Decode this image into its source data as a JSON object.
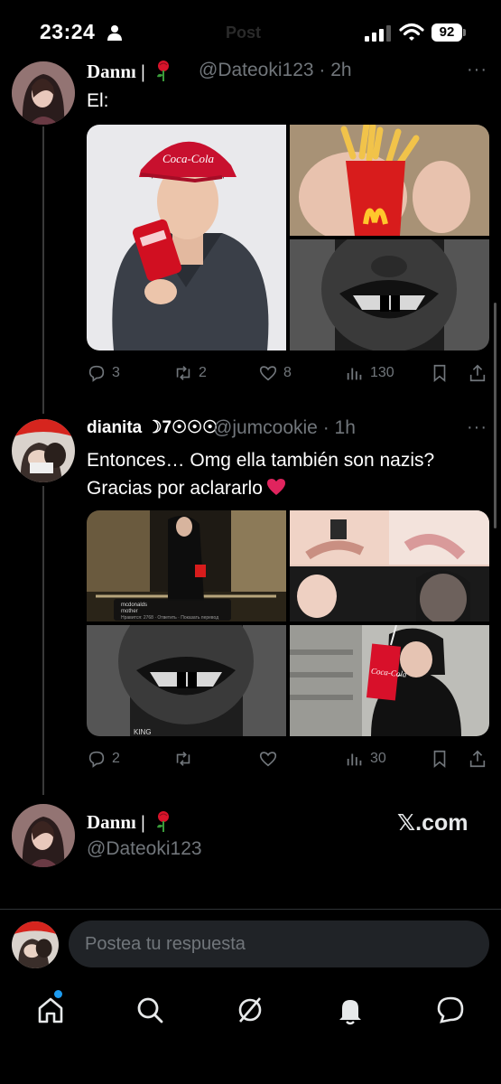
{
  "status_bar": {
    "time": "23:24",
    "battery": "92",
    "ghost_title": "Post"
  },
  "tweet1": {
    "name": "Dannı |",
    "handle": "@Dateoki123",
    "time": "· 2h",
    "more": "···",
    "text": "El:",
    "stats": {
      "replies": "3",
      "reposts": "2",
      "likes": "8",
      "views": "130"
    },
    "image_text": {
      "brand": "Coca-Cola"
    }
  },
  "tweet2": {
    "name": "dianita ☽7☉☉☉",
    "handle": "@jumcookie",
    "time": "· 1h",
    "more": "···",
    "text_line1": "Entonces… Omg ella también son nazis?",
    "text_line2": "Gracias por aclararlo",
    "stats": {
      "replies": "2",
      "reposts": "",
      "likes": "",
      "views": "30"
    },
    "image_text": {
      "overlay_user": "mcdonalds",
      "overlay_caption": "mother",
      "overlay_actions": "Нравится: 2768 · Ответить · Показать перевод",
      "caption_king": "KING",
      "brand": "Coca-Cola"
    }
  },
  "quote_card": {
    "name": "Dannı |",
    "handle": "@Dateoki123",
    "source": "𝕏.com"
  },
  "reply": {
    "placeholder": "Postea tu respuesta"
  },
  "tabs": [
    "home-icon",
    "search-icon",
    "grok-icon",
    "notifications-icon",
    "messages-icon"
  ],
  "colors": {
    "background": "#000000",
    "secondary_text": "#71767b",
    "accent": "#1d9bf0",
    "heart": "#e0245e"
  }
}
